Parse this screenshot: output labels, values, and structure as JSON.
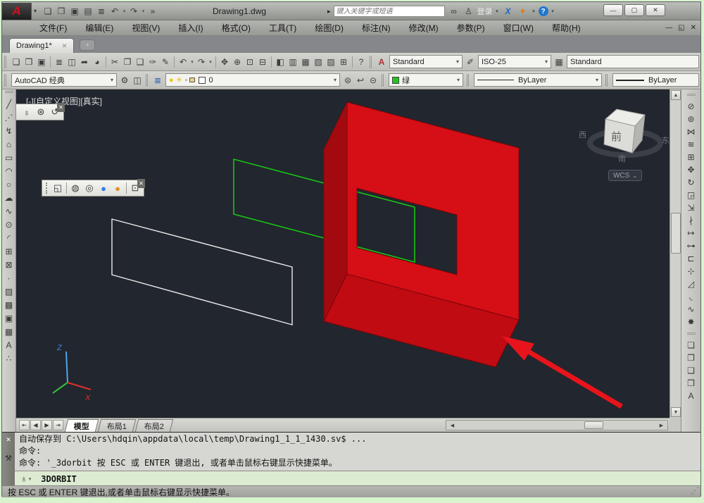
{
  "window": {
    "title": "Drawing1.dwg",
    "buttons": [
      {
        "name": "minimize-button",
        "glyph": "—"
      },
      {
        "name": "maximize-button",
        "glyph": "▢"
      },
      {
        "name": "close-button",
        "glyph": "✕"
      }
    ]
  },
  "titlebar": {
    "logo_letter": "A",
    "logo_dd": "▾",
    "quick_access": [
      {
        "name": "new-icon",
        "glyph": "❏"
      },
      {
        "name": "open-icon",
        "glyph": "❒"
      },
      {
        "name": "save-icon",
        "glyph": "▣"
      },
      {
        "name": "save-as-icon",
        "glyph": "▤"
      },
      {
        "name": "print-icon",
        "glyph": "≣"
      },
      {
        "name": "undo-icon",
        "glyph": "↶"
      },
      {
        "name": "undo-dropdown-icon",
        "glyph": "▾",
        "cls": "dd"
      },
      {
        "name": "redo-icon",
        "glyph": "↷"
      },
      {
        "name": "redo-dropdown-icon",
        "glyph": "▾",
        "cls": "dd"
      },
      {
        "name": "more-tools-icon",
        "glyph": "»"
      }
    ],
    "search_expand": "▸",
    "search_placeholder": "键入关键字或短语",
    "right_icons": [
      {
        "name": "search-icon",
        "glyph": "∞"
      },
      {
        "name": "user-icon",
        "glyph": "♙"
      },
      {
        "name": "login-label",
        "glyph": "登录",
        "cls": "txt"
      },
      {
        "name": "login-dropdown-icon",
        "glyph": "▾",
        "cls": "dd"
      },
      {
        "name": "exchange-icon",
        "glyph": "X",
        "cls": "xblue"
      },
      {
        "name": "apps-icon",
        "glyph": "✦",
        "cls": "orange"
      },
      {
        "name": "apps-dropdown-icon",
        "glyph": "▾",
        "cls": "dd"
      },
      {
        "name": "help-icon",
        "glyph": "?",
        "cls": "help"
      },
      {
        "name": "help-dropdown-icon",
        "glyph": "▾",
        "cls": "dd"
      }
    ]
  },
  "menubar": {
    "items": [
      "文件(F)",
      "编辑(E)",
      "视图(V)",
      "插入(I)",
      "格式(O)",
      "工具(T)",
      "绘图(D)",
      "标注(N)",
      "修改(M)",
      "参数(P)",
      "窗口(W)",
      "帮助(H)"
    ],
    "doc_buttons": [
      {
        "name": "doc-minimize-icon",
        "glyph": "—"
      },
      {
        "name": "doc-restore-icon",
        "glyph": "◱"
      },
      {
        "name": "doc-close-icon",
        "glyph": "✕"
      }
    ]
  },
  "file_tabs": {
    "active_label": "Drawing1*",
    "close": "✕",
    "new_tab": "+"
  },
  "toolbar1": {
    "icons": [
      {
        "name": "new-icon",
        "glyph": "❏"
      },
      {
        "name": "open-icon",
        "glyph": "❒"
      },
      {
        "name": "save-icon",
        "glyph": "▣"
      },
      {
        "name": "separator",
        "glyph": "",
        "cls": "sep"
      },
      {
        "name": "print-icon",
        "glyph": "≣"
      },
      {
        "name": "print-preview-icon",
        "glyph": "◫"
      },
      {
        "name": "publish-icon",
        "glyph": "➦"
      },
      {
        "name": "plot-styles-icon",
        "glyph": "◕"
      },
      {
        "name": "separator",
        "glyph": "",
        "cls": "sep"
      },
      {
        "name": "cut-icon",
        "glyph": "✂"
      },
      {
        "name": "copy-icon",
        "glyph": "❐"
      },
      {
        "name": "paste-icon",
        "glyph": "❑"
      },
      {
        "name": "match-properties-icon",
        "glyph": "✑"
      },
      {
        "name": "block-editor-icon",
        "glyph": "✎"
      },
      {
        "name": "separator",
        "glyph": "",
        "cls": "sep"
      },
      {
        "name": "undo-icon",
        "glyph": "↶"
      },
      {
        "name": "undo-dropdown-icon",
        "glyph": "▾",
        "cls": "dd"
      },
      {
        "name": "redo-icon",
        "glyph": "↷"
      },
      {
        "name": "redo-dropdown-icon",
        "glyph": "▾",
        "cls": "dd"
      },
      {
        "name": "separator",
        "glyph": "",
        "cls": "sep"
      },
      {
        "name": "pan-icon",
        "glyph": "✥"
      },
      {
        "name": "zoom-realtime-icon",
        "glyph": "⊕"
      },
      {
        "name": "zoom-window-icon",
        "glyph": "⊡"
      },
      {
        "name": "zoom-previous-icon",
        "glyph": "⊟"
      },
      {
        "name": "separator",
        "glyph": "",
        "cls": "sep"
      },
      {
        "name": "properties-icon",
        "glyph": "◧"
      },
      {
        "name": "designcenter-icon",
        "glyph": "▥"
      },
      {
        "name": "tool-palettes-icon",
        "glyph": "▦"
      },
      {
        "name": "sheet-set-icon",
        "glyph": "▧"
      },
      {
        "name": "markup-set-icon",
        "glyph": "▨"
      },
      {
        "name": "quickcalc-icon",
        "glyph": "⊞"
      },
      {
        "name": "separator",
        "glyph": "",
        "cls": "sep"
      },
      {
        "name": "help-icon",
        "glyph": "?"
      }
    ],
    "text_style": {
      "icon": "A",
      "label": "Standard",
      "arrow": "▾"
    },
    "dim_style": {
      "icon": "✐",
      "label": "ISO-25",
      "arrow": "▾"
    },
    "table_style": {
      "icon": "▦",
      "label": "Standard",
      "arrow": "▾"
    }
  },
  "toolbar2": {
    "workspace_label": "AutoCAD 经典",
    "workspace_arrow": "▾",
    "workspace_icons": [
      {
        "name": "workspace-settings-icon",
        "glyph": "⚙"
      },
      {
        "name": "workspace-save-icon",
        "glyph": "◫"
      }
    ],
    "layers_manager_icon": "≣",
    "layer_box": {
      "bulb": "●",
      "sun": "☀",
      "plot": "▫",
      "layer_name": "0",
      "arrow": "▾"
    },
    "layer_icons": [
      {
        "name": "layer-states-icon",
        "glyph": "⊜"
      },
      {
        "name": "layer-previous-icon",
        "glyph": "↩"
      },
      {
        "name": "layer-isolate-icon",
        "glyph": "⊝"
      }
    ],
    "color_label": "绿",
    "color_arrow": "▾",
    "linetype_label": "ByLayer",
    "linetype_arrow": "▾",
    "lineweight_label": "ByLayer",
    "lineweight_arrow": "▾"
  },
  "viewport": {
    "label": "[-][自定义视图][真实]",
    "viewcube": {
      "front": "前",
      "south": "南",
      "west": "西",
      "east": "东",
      "wcs": "WCS",
      "wcs_arrow": "⌄"
    },
    "ucs": {
      "z": "Z",
      "x": "X"
    }
  },
  "orbit_toolbar": {
    "icons": [
      {
        "name": "constrained-orbit-icon",
        "glyph": "♁"
      },
      {
        "name": "free-orbit-icon",
        "glyph": "⊛"
      },
      {
        "name": "continuous-orbit-icon",
        "glyph": "↺"
      }
    ],
    "close": "✕"
  },
  "visual_toolbar": {
    "icons": [
      {
        "name": "2d-wireframe-icon",
        "glyph": "◱"
      },
      {
        "name": "separator",
        "glyph": "",
        "cls": "sep"
      },
      {
        "name": "3d-wireframe-icon",
        "glyph": "◍"
      },
      {
        "name": "3d-hidden-icon",
        "glyph": "◎"
      },
      {
        "name": "realistic-style-icon",
        "glyph": "●",
        "color": "#2f7fe0"
      },
      {
        "name": "conceptual-style-icon",
        "glyph": "●",
        "color": "#d9952a"
      },
      {
        "name": "separator",
        "glyph": "",
        "cls": "sep"
      },
      {
        "name": "manage-visual-styles-icon",
        "glyph": "⊡"
      }
    ],
    "close": "✕"
  },
  "draw_toolbar": {
    "icons": [
      {
        "name": "line-icon",
        "glyph": "╱"
      },
      {
        "name": "construction-line-icon",
        "glyph": "⋰"
      },
      {
        "name": "polyline-icon",
        "glyph": "↯"
      },
      {
        "name": "polygon-icon",
        "glyph": "⌂"
      },
      {
        "name": "rectangle-icon",
        "glyph": "▭"
      },
      {
        "name": "arc-icon",
        "glyph": "◠"
      },
      {
        "name": "circle-icon",
        "glyph": "○"
      },
      {
        "name": "revision-cloud-icon",
        "glyph": "☁"
      },
      {
        "name": "spline-icon",
        "glyph": "∿"
      },
      {
        "name": "ellipse-icon",
        "glyph": "⊙"
      },
      {
        "name": "ellipse-arc-icon",
        "glyph": "◜"
      },
      {
        "name": "insert-block-icon",
        "glyph": "⊞"
      },
      {
        "name": "make-block-icon",
        "glyph": "⊠"
      },
      {
        "name": "point-icon",
        "glyph": "∙"
      },
      {
        "name": "hatch-icon",
        "glyph": "▨"
      },
      {
        "name": "gradient-icon",
        "glyph": "▩"
      },
      {
        "name": "region-icon",
        "glyph": "▣"
      },
      {
        "name": "table-icon",
        "glyph": "▦"
      },
      {
        "name": "multiline-text-icon",
        "glyph": "A"
      },
      {
        "name": "point-cloud-icon",
        "glyph": "∴"
      }
    ]
  },
  "modify_toolbar": {
    "icons": [
      {
        "name": "erase-icon",
        "glyph": "⊘"
      },
      {
        "name": "copy-icon",
        "glyph": "⊚"
      },
      {
        "name": "mirror-icon",
        "glyph": "⋈"
      },
      {
        "name": "offset-icon",
        "glyph": "≋"
      },
      {
        "name": "array-icon",
        "glyph": "⊞"
      },
      {
        "name": "move-icon",
        "glyph": "✥"
      },
      {
        "name": "rotate-icon",
        "glyph": "↻"
      },
      {
        "name": "scale-icon",
        "glyph": "◲"
      },
      {
        "name": "stretch-icon",
        "glyph": "⇲"
      },
      {
        "name": "trim-icon",
        "glyph": "∤"
      },
      {
        "name": "extend-icon",
        "glyph": "↦"
      },
      {
        "name": "break-at-point-icon",
        "glyph": "⊶"
      },
      {
        "name": "break-icon",
        "glyph": "⊏"
      },
      {
        "name": "join-icon",
        "glyph": "⊹"
      },
      {
        "name": "chamfer-icon",
        "glyph": "◿"
      },
      {
        "name": "fillet-icon",
        "glyph": "◟"
      },
      {
        "name": "blend-curves-icon",
        "glyph": "∿"
      },
      {
        "name": "explode-icon",
        "glyph": "✸"
      }
    ]
  },
  "draworder_toolbar": {
    "icons": [
      {
        "name": "bring-to-front-icon",
        "glyph": "❏"
      },
      {
        "name": "send-to-back-icon",
        "glyph": "❐"
      },
      {
        "name": "bring-above-objects-icon",
        "glyph": "❑"
      },
      {
        "name": "send-under-objects-icon",
        "glyph": "❒"
      },
      {
        "name": "text-to-front-icon",
        "glyph": "A"
      }
    ]
  },
  "layout_tabs": {
    "nav": [
      {
        "name": "first-tab-icon",
        "glyph": "⇤"
      },
      {
        "name": "prev-tab-icon",
        "glyph": "◀"
      },
      {
        "name": "next-tab-icon",
        "glyph": "▶"
      },
      {
        "name": "last-tab-icon",
        "glyph": "⇥"
      }
    ],
    "model": "模型",
    "layout1": "布局1",
    "layout2": "布局2"
  },
  "command": {
    "history": [
      "自动保存到 C:\\Users\\hdqin\\appdata\\local\\temp\\Drawing1_1_1_1430.sv$ ...",
      "命令:",
      "命令: '_3dorbit 按 ESC 或 ENTER 键退出, 或者单击鼠标右键显示快捷菜单。"
    ],
    "prompt_icon": "♁",
    "prompt_dd": "▾",
    "input": "3DORBIT",
    "close": "✕",
    "customize_icon": "⚒"
  },
  "statusbar": {
    "message": "按 ESC 或 ENTER 键退出,或者单击鼠标右键显示快捷菜单。",
    "grip": "⋰"
  },
  "colors": {
    "red_front": "#d60e15",
    "red_left": "#a30a10",
    "red_bottom": "#c00b12",
    "red_edge": "#7c0509",
    "green_wire": "#17c517",
    "white_wire": "#ebebeb",
    "arrow": "#e8141c",
    "viewport_bg": "#22262e",
    "layer_color_swatch": "#ffffff",
    "current_color_swatch": "#22c522"
  }
}
